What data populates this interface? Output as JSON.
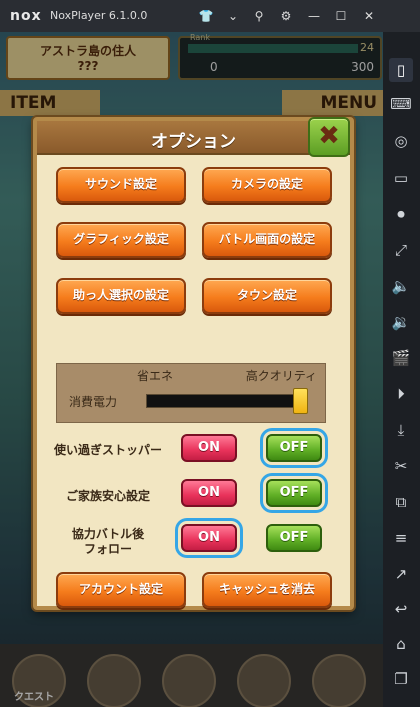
{
  "window": {
    "logo": "nox",
    "title": "NoxPlayer 6.1.0.0"
  },
  "titlebar_icons": [
    "shirt-icon",
    "chevron-down-icon",
    "pin-icon",
    "gear-icon",
    "minimize-icon",
    "maximize-icon",
    "close-icon"
  ],
  "titlebar_glyphs": {
    "shirt": "👕",
    "chevron": "⌄",
    "pin": "⚲",
    "gear": "⚙",
    "min": "—",
    "max": "☐",
    "close": "✕"
  },
  "sidebar_glyphs": [
    "▯",
    "⌨",
    "◎",
    "▭",
    "⏺",
    "⤢",
    "🔈",
    "🔉",
    "🎬",
    "⏵",
    "⤓",
    "✂",
    "⧉",
    "≡",
    "↗",
    "↩",
    "⌂",
    "❐"
  ],
  "hud": {
    "player_title": "アストラ島の住人",
    "player_name": "???",
    "rank_label": "Rank",
    "rank_level": "24",
    "currency_1": "0",
    "currency_2": "300"
  },
  "banners": {
    "item": "ITEM",
    "menu": "MENU"
  },
  "bottom_nav": {
    "quest_label": "クエスト"
  },
  "dialog": {
    "title": "オプション",
    "close_glyph": "✖",
    "buttons": [
      {
        "label": "サウンド設定"
      },
      {
        "label": "カメラの設定"
      },
      {
        "label": "グラフィック設定"
      },
      {
        "label": "バトル画面の設定"
      },
      {
        "label": "助っ人選択の設定"
      },
      {
        "label": "タウン設定"
      }
    ],
    "power": {
      "label": "消費電力",
      "low": "省エネ",
      "high": "高クオリティ",
      "level": 1.0
    },
    "toggles": [
      {
        "label": "使い過ぎストッパー",
        "on": "ON",
        "off": "OFF",
        "selected": "OFF"
      },
      {
        "label": "ご家族安心設定",
        "on": "ON",
        "off": "OFF",
        "selected": "OFF"
      },
      {
        "label_line1": "協力バトル後",
        "label_line2": "フォロー",
        "on": "ON",
        "off": "OFF",
        "selected": "ON"
      }
    ],
    "footer_buttons": [
      {
        "label": "アカウント設定"
      },
      {
        "label": "キャッシュを消去"
      }
    ]
  }
}
